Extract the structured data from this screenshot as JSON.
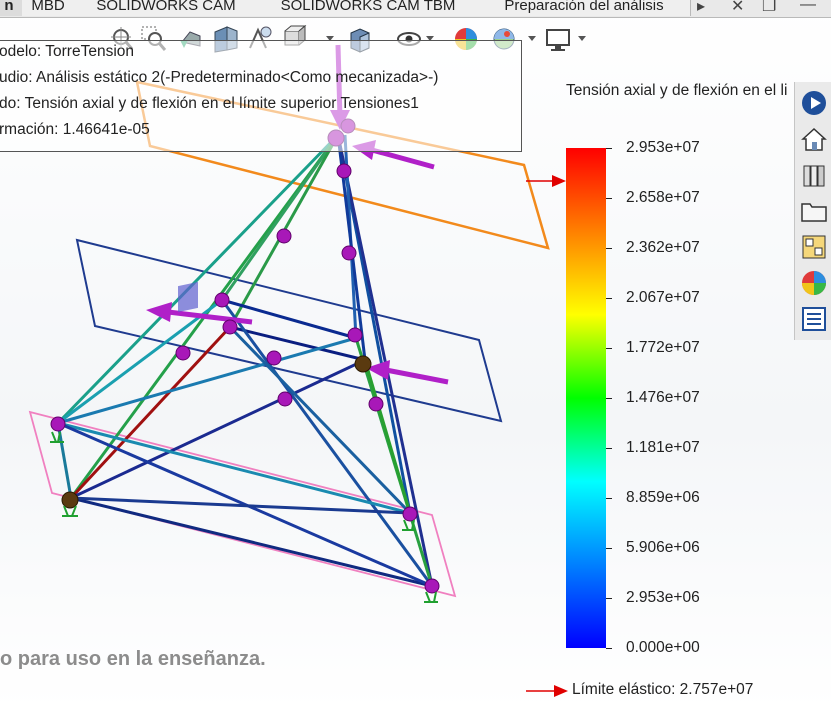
{
  "tabs": [
    "n",
    "MBD",
    "SOLIDWORKS CAM",
    "SOLIDWORKS CAM TBM",
    "Preparación del análisis"
  ],
  "window_controls": {
    "minimize": "—",
    "restore": "❐",
    "close": "✕",
    "more": "▸"
  },
  "info": {
    "model": "odelo: TorreTension",
    "study": "udio: Análisis estático 2(-Predeterminado<Como mecanizada>-)",
    "result": "do: Tensión axial y de flexión en el límite superior Tensiones1",
    "deformation": "rmación: 1.46641e-05"
  },
  "legend": {
    "title": "Tensión axial y de flexión en el li",
    "ticks": [
      "2.953e+07",
      "2.658e+07",
      "2.362e+07",
      "2.067e+07",
      "1.772e+07",
      "1.476e+07",
      "1.181e+07",
      "8.859e+06",
      "5.906e+06",
      "2.953e+06",
      "0.000e+00"
    ],
    "colors": [
      "#ff0000",
      "#ff8000",
      "#ffff00",
      "#00ff00",
      "#00ffff",
      "#0080ff",
      "#0000ff"
    ],
    "limit_label": "Límite elástico: 2.757e+07",
    "limit_fraction": 0.934
  },
  "watermark": "o para uso en la enseñanza.",
  "toolbar_icons": [
    "zoom-to-fit-icon",
    "zoom-to-area-icon",
    "previous-view-icon",
    "section-view-icon",
    "dynamic-annotation-icon",
    "view-orientation-icon",
    "display-style-icon",
    "hide-show-icon",
    "edit-appearance-icon",
    "apply-scene-icon",
    "view-settings-icon"
  ],
  "side_icons": [
    "solidworks-resources-icon",
    "home-icon",
    "design-library-icon",
    "file-explorer-icon",
    "view-palette-icon",
    "appearances-icon",
    "custom-properties-icon"
  ],
  "accent": {
    "orange_plane": "#f28a1c",
    "blue_plane": "#1f3b8f",
    "pink_plane": "#f080c0",
    "joint": "#b020b8",
    "load_arrow": "#b020c8"
  }
}
